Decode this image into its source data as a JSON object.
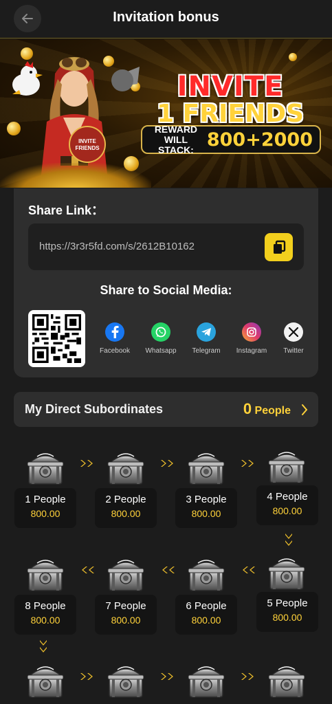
{
  "header": {
    "title": "Invitation bonus"
  },
  "banner": {
    "line1": "INVITE",
    "line2": "1 FRIENDS",
    "reward_label_1": "REWARD",
    "reward_label_2": "WILL STACK:",
    "reward_value": "800+2000",
    "badge_1": "INVITE",
    "badge_2": "FRIENDS"
  },
  "share": {
    "title": "Share Link：",
    "link": "https://3r3r5fd.com/s/2612B10162",
    "social_title": "Share to Social Media:",
    "networks": [
      {
        "label": "Facebook",
        "color": "#1877f2"
      },
      {
        "label": "Whatsapp",
        "color": "#25d366"
      },
      {
        "label": "Telegram",
        "color": "#2aa3dd"
      },
      {
        "label": "Instagram",
        "color": "#d6296d"
      },
      {
        "label": "Twitter",
        "color": "#000000"
      }
    ]
  },
  "subordinates": {
    "title": "My Direct Subordinates",
    "count": "0",
    "unit": "People"
  },
  "tiers": [
    {
      "people": "1 People",
      "amount": "800.00"
    },
    {
      "people": "2 People",
      "amount": "800.00"
    },
    {
      "people": "3 People",
      "amount": "800.00"
    },
    {
      "people": "4 People",
      "amount": "800.00"
    },
    {
      "people": "5 People",
      "amount": "800.00"
    },
    {
      "people": "6 People",
      "amount": "800.00"
    },
    {
      "people": "7 People",
      "amount": "800.00"
    },
    {
      "people": "8 People",
      "amount": "800.00"
    }
  ],
  "colors": {
    "accent": "#ffd23a",
    "copy_button": "#f2cf1d",
    "card": "#2e2e2e",
    "background": "#1c1c1c"
  }
}
